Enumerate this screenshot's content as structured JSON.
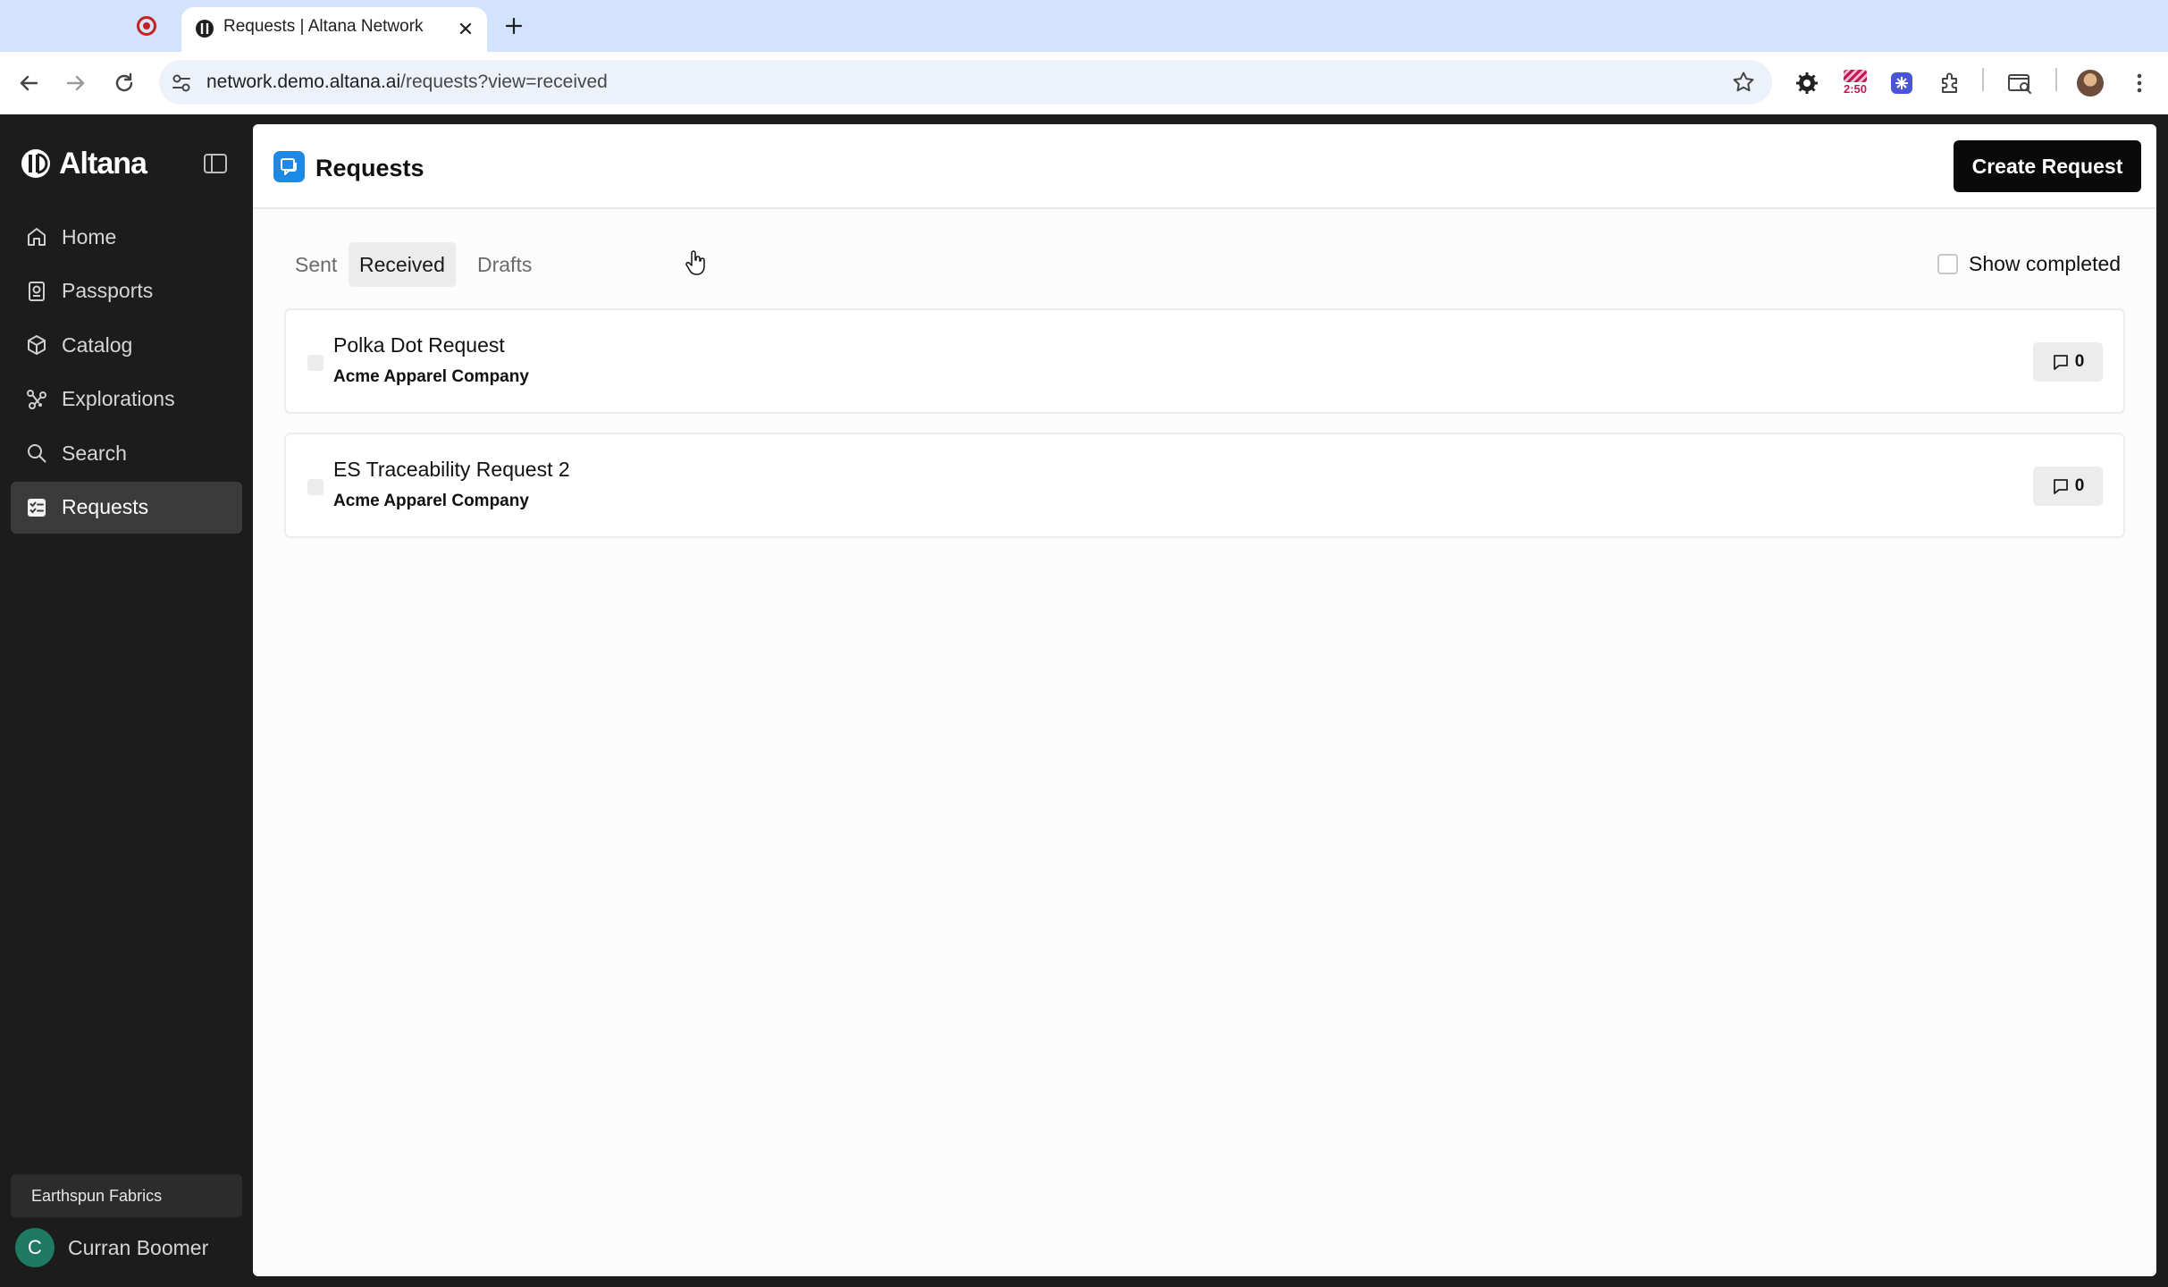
{
  "browser": {
    "tab_title": "Requests | Altana Network",
    "url_host": "network.demo.altana.ai",
    "url_path": "/requests?view=received",
    "extension_badge_time": "2:50"
  },
  "sidebar": {
    "brand": "Altana",
    "items": [
      {
        "label": "Home",
        "icon": "home-icon"
      },
      {
        "label": "Passports",
        "icon": "passport-icon"
      },
      {
        "label": "Catalog",
        "icon": "cube-icon"
      },
      {
        "label": "Explorations",
        "icon": "graph-icon"
      },
      {
        "label": "Search",
        "icon": "search-icon"
      },
      {
        "label": "Requests",
        "icon": "checklist-icon",
        "active": true
      }
    ],
    "org_name": "Earthspun Fabrics",
    "user": {
      "initial": "C",
      "name": "Curran Boomer"
    }
  },
  "header": {
    "title": "Requests",
    "create_label": "Create Request"
  },
  "tabs": {
    "sent": "Sent",
    "received": "Received",
    "drafts": "Drafts",
    "active": "received"
  },
  "filter": {
    "show_completed_label": "Show completed",
    "show_completed": false
  },
  "requests": [
    {
      "name": "Polka Dot Request",
      "company": "Acme Apparel Company",
      "comments": "0"
    },
    {
      "name": "ES Traceability Request 2",
      "company": "Acme Apparel Company",
      "comments": "0"
    }
  ],
  "colors": {
    "accent": "#1e88e5",
    "primary_button": "#0a0a0a",
    "sidebar_bg": "#1c1c1c"
  }
}
